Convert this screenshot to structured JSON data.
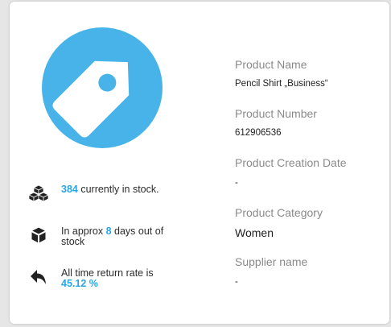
{
  "colors": {
    "accent": "#2aa6e6",
    "icon_circle": "#47b3e8"
  },
  "stats": {
    "stock": {
      "value": "384",
      "suffix": " currently in stock.",
      "icon": "cubes-icon"
    },
    "days_out": {
      "prefix": "In approx ",
      "value": "8",
      "suffix": " days out of stock",
      "icon": "cube-icon"
    },
    "return_rate": {
      "prefix": "All time return rate is",
      "value": "45.12 %",
      "icon": "return-arrow-icon"
    }
  },
  "fields": {
    "product_name": {
      "label": "Product Name",
      "value": "Pencil Shirt „Business“"
    },
    "product_number": {
      "label": "Product Number",
      "value": "612906536"
    },
    "creation_date": {
      "label": "Product Creation Date",
      "value": "-"
    },
    "category": {
      "label": "Product Category",
      "value": "Women"
    },
    "supplier": {
      "label": "Supplier name",
      "value": "-"
    }
  }
}
